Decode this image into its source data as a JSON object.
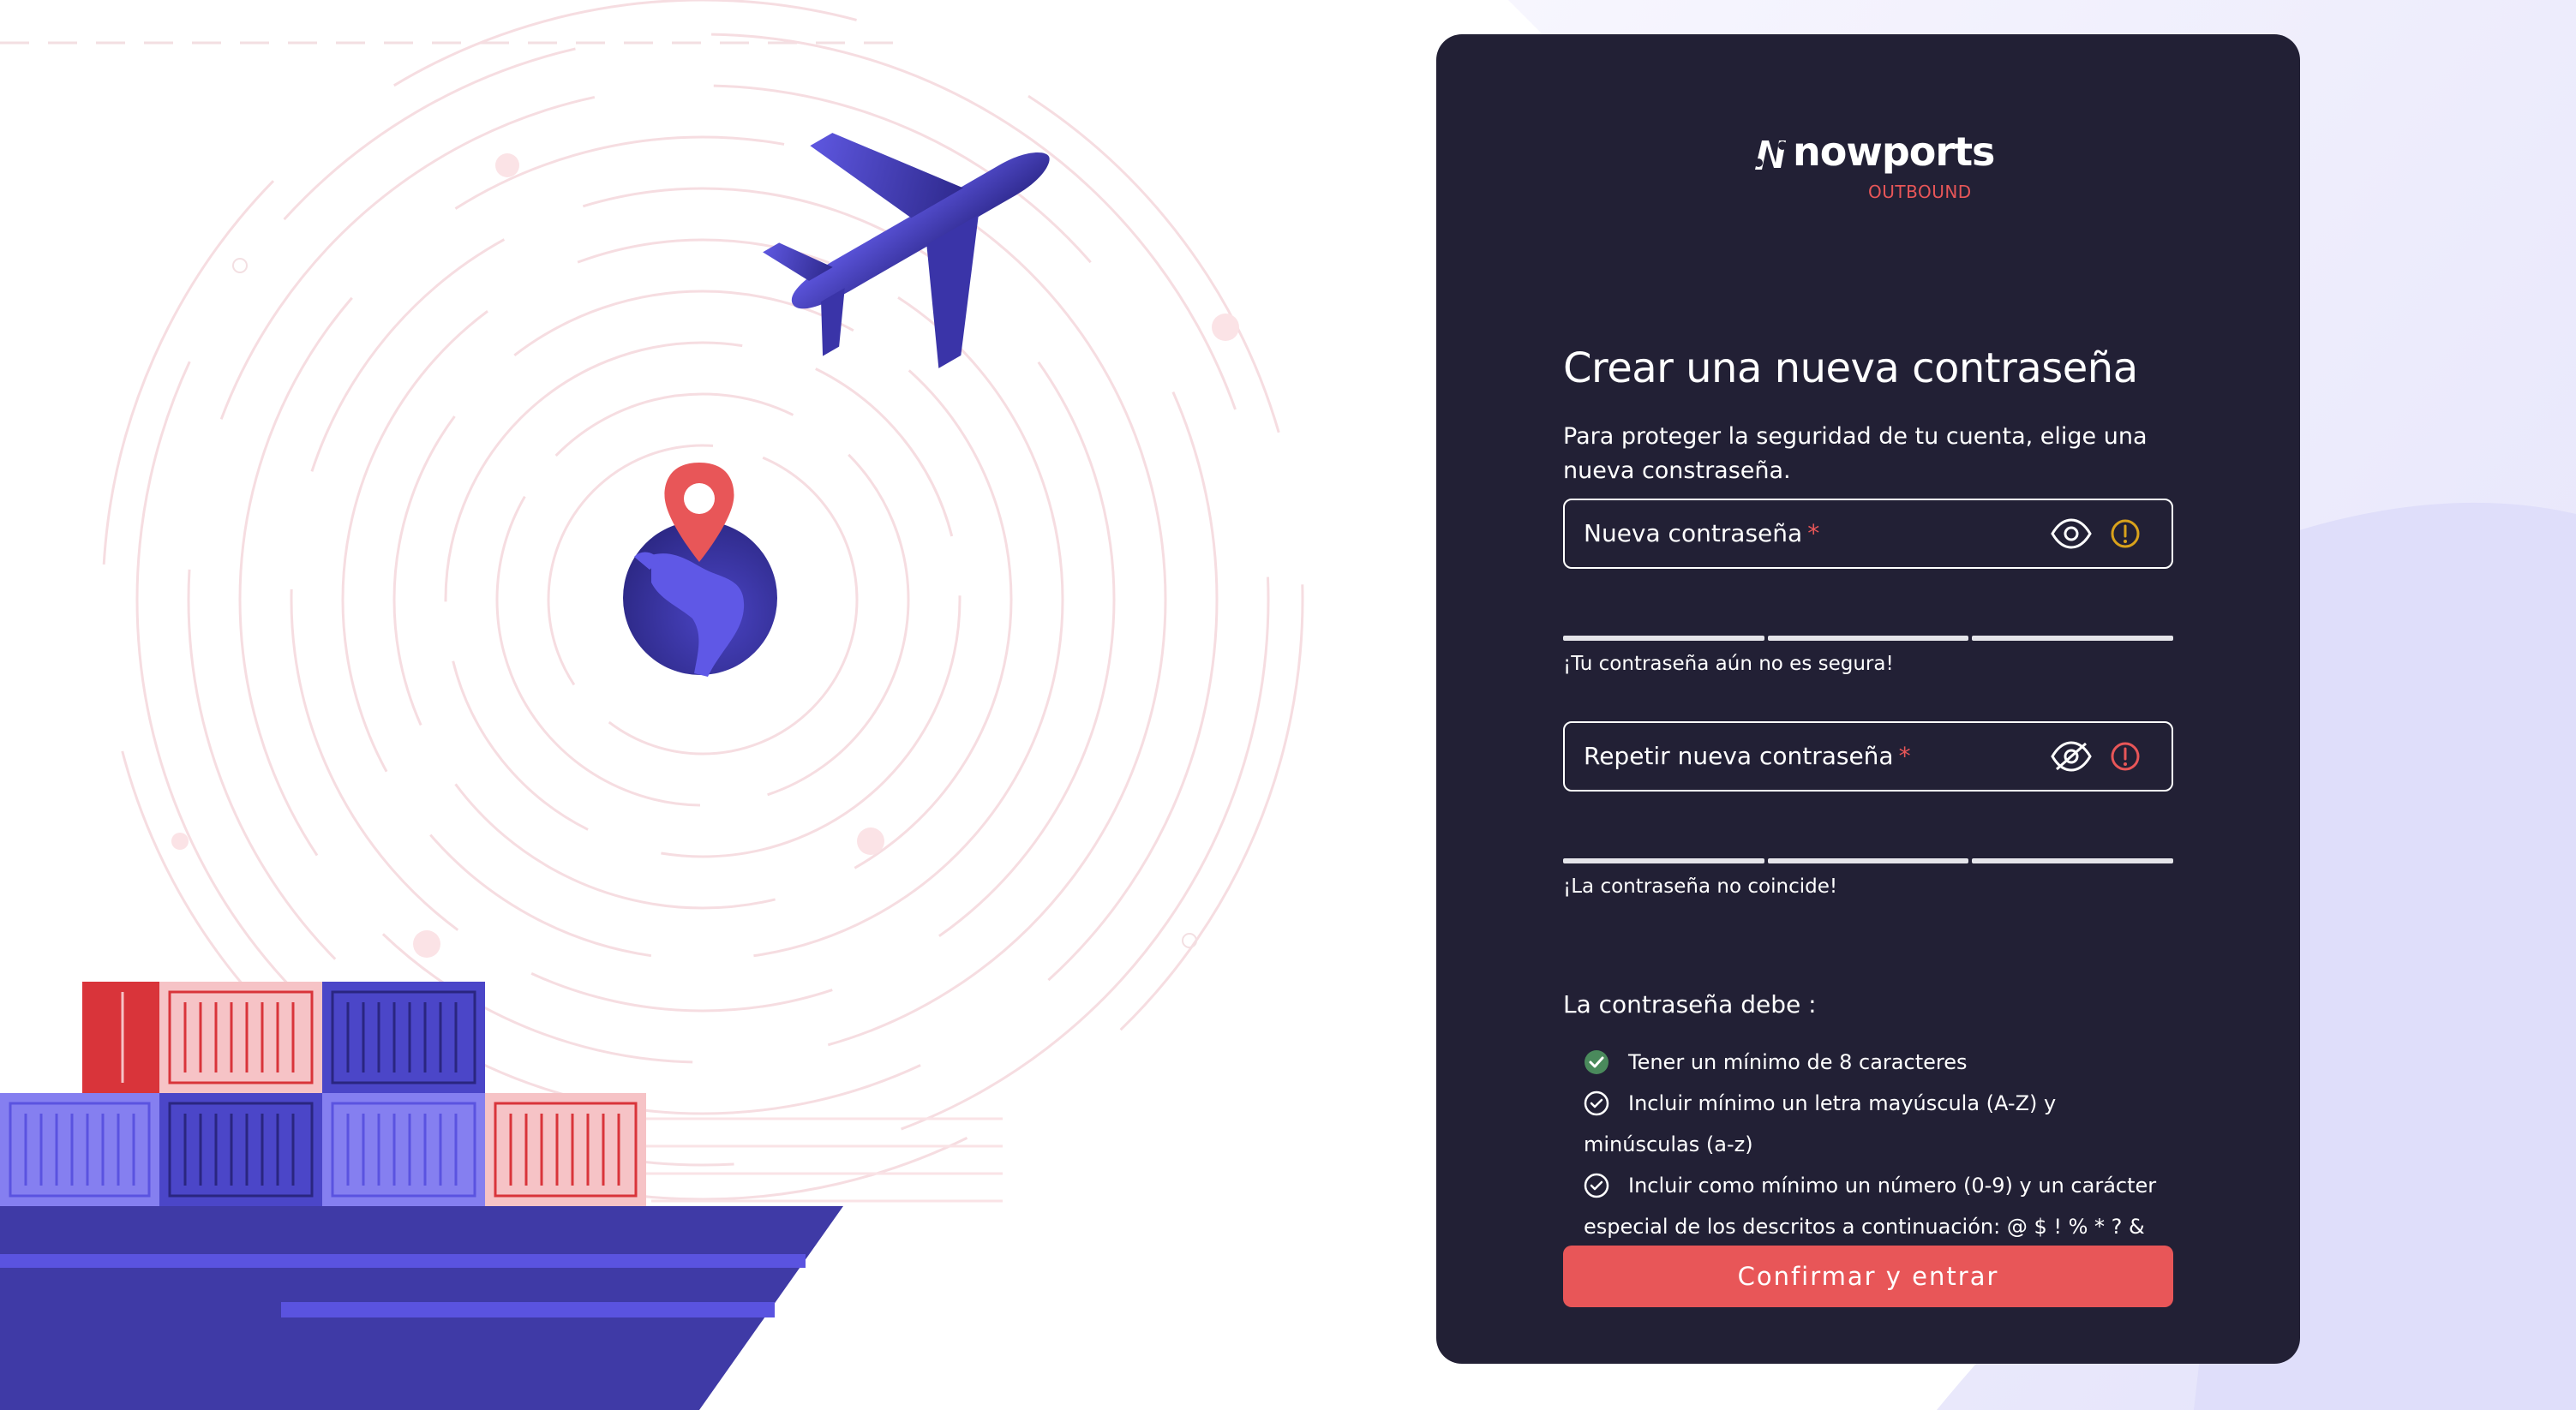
{
  "brand": {
    "name": "nowports",
    "product": "OUTBOUND"
  },
  "form": {
    "title": "Crear una nueva contraseña",
    "subtitle": "Para proteger la seguridad de tu cuenta, elige una nueva constraseña.",
    "new_password": {
      "label": "Nueva contraseña",
      "required_mark": "*",
      "visibility_icon": "eye-icon",
      "status_icon": "warning-icon",
      "status_color": "#d9a21b",
      "hint": "¡Tu contraseña aún no es segura!"
    },
    "repeat_password": {
      "label": "Repetir nueva contraseña",
      "required_mark": "*",
      "visibility_icon": "eye-off-icon",
      "status_icon": "error-icon",
      "status_color": "#e85658",
      "hint": "¡La contraseña no coincide!"
    },
    "rules_title": "La contraseña debe :",
    "rules": [
      {
        "text": "Tener un mínimo de 8 caracteres",
        "met": true
      },
      {
        "text": "Incluir mínimo un letra mayúscula (A-Z) y minúsculas (a-z)",
        "met": false
      },
      {
        "text": "Incluir como mínimo un número (0-9) y un carácter especial de los descritos a continuación: @ $ ! % * ? &",
        "met": false
      }
    ],
    "submit_label": "Confirmar y entrar"
  },
  "colors": {
    "card": "#222035",
    "accent": "#e85658",
    "brand_purple": "#4b46c8",
    "success": "#4a8a5c"
  }
}
